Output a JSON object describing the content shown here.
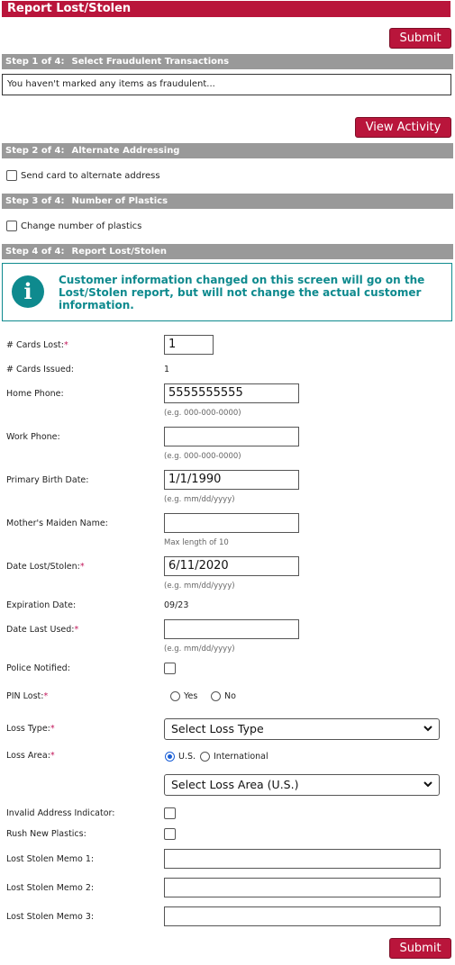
{
  "header": {
    "title": "Report Lost/Stolen"
  },
  "buttons": {
    "submit_top": "Submit",
    "view_activity": "View Activity",
    "submit_bottom": "Submit"
  },
  "steps": [
    {
      "label": "Step 1 of 4:",
      "title": "Select Fraudulent Transactions"
    },
    {
      "label": "Step 2 of 4:",
      "title": "Alternate Addressing"
    },
    {
      "label": "Step 3 of 4:",
      "title": "Number of Plastics"
    },
    {
      "label": "Step 4 of 4:",
      "title": "Report Lost/Stolen"
    }
  ],
  "fraud_message": "You haven't marked any items as fraudulent...",
  "alt_address": {
    "label": "Send card to alternate address",
    "checked": false
  },
  "plastics": {
    "label": "Change number of plastics",
    "checked": false
  },
  "info_message": "Customer information changed on this screen will go on the Lost/Stolen report, but will not change the actual customer information.",
  "form": {
    "cards_lost": {
      "label": "# Cards Lost:",
      "required": "*",
      "value": "1"
    },
    "cards_issued": {
      "label": "# Cards Issued:",
      "value": "1"
    },
    "home_phone": {
      "label": "Home Phone:",
      "value": "5555555555",
      "hint": "(e.g. 000-000-0000)"
    },
    "work_phone": {
      "label": "Work Phone:",
      "value": "",
      "hint": "(e.g. 000-000-0000)"
    },
    "birth_date": {
      "label": "Primary Birth Date:",
      "value": "1/1/1990",
      "hint": "(e.g. mm/dd/yyyy)"
    },
    "maiden_name": {
      "label": "Mother's Maiden Name:",
      "value": "",
      "hint": "Max length of 10"
    },
    "date_lost": {
      "label": "Date Lost/Stolen:",
      "required": "*",
      "value": "6/11/2020",
      "hint": "(e.g. mm/dd/yyyy)"
    },
    "expiration": {
      "label": "Expiration Date:",
      "value": "09/23"
    },
    "date_last_used": {
      "label": "Date Last Used:",
      "required": "*",
      "value": "",
      "hint": "(e.g. mm/dd/yyyy)"
    },
    "police_notified": {
      "label": "Police Notified:",
      "checked": false
    },
    "pin_lost": {
      "label": "PIN Lost:",
      "required": "*",
      "options": [
        "Yes",
        "No"
      ],
      "selected": null
    },
    "loss_type": {
      "label": "Loss Type:",
      "required": "*",
      "selected": "Select Loss Type"
    },
    "loss_area": {
      "label": "Loss Area:",
      "required": "*",
      "options": [
        "U.S.",
        "International"
      ],
      "selected": "U.S.",
      "select_value": "Select Loss Area (U.S.)"
    },
    "invalid_address": {
      "label": "Invalid Address Indicator:",
      "checked": false
    },
    "rush_plastics": {
      "label": "Rush New Plastics:",
      "checked": false
    },
    "memo1": {
      "label": "Lost Stolen Memo 1:",
      "value": ""
    },
    "memo2": {
      "label": "Lost Stolen Memo 2:",
      "value": ""
    },
    "memo3": {
      "label": "Lost Stolen Memo 3:",
      "value": ""
    }
  },
  "colors": {
    "accent": "#b9153b",
    "step_bar": "#999999",
    "info": "#0e8a8e",
    "required": "#c2185b"
  },
  "icons": {
    "info": "info-icon",
    "dropdown": "chevron-down-icon"
  }
}
